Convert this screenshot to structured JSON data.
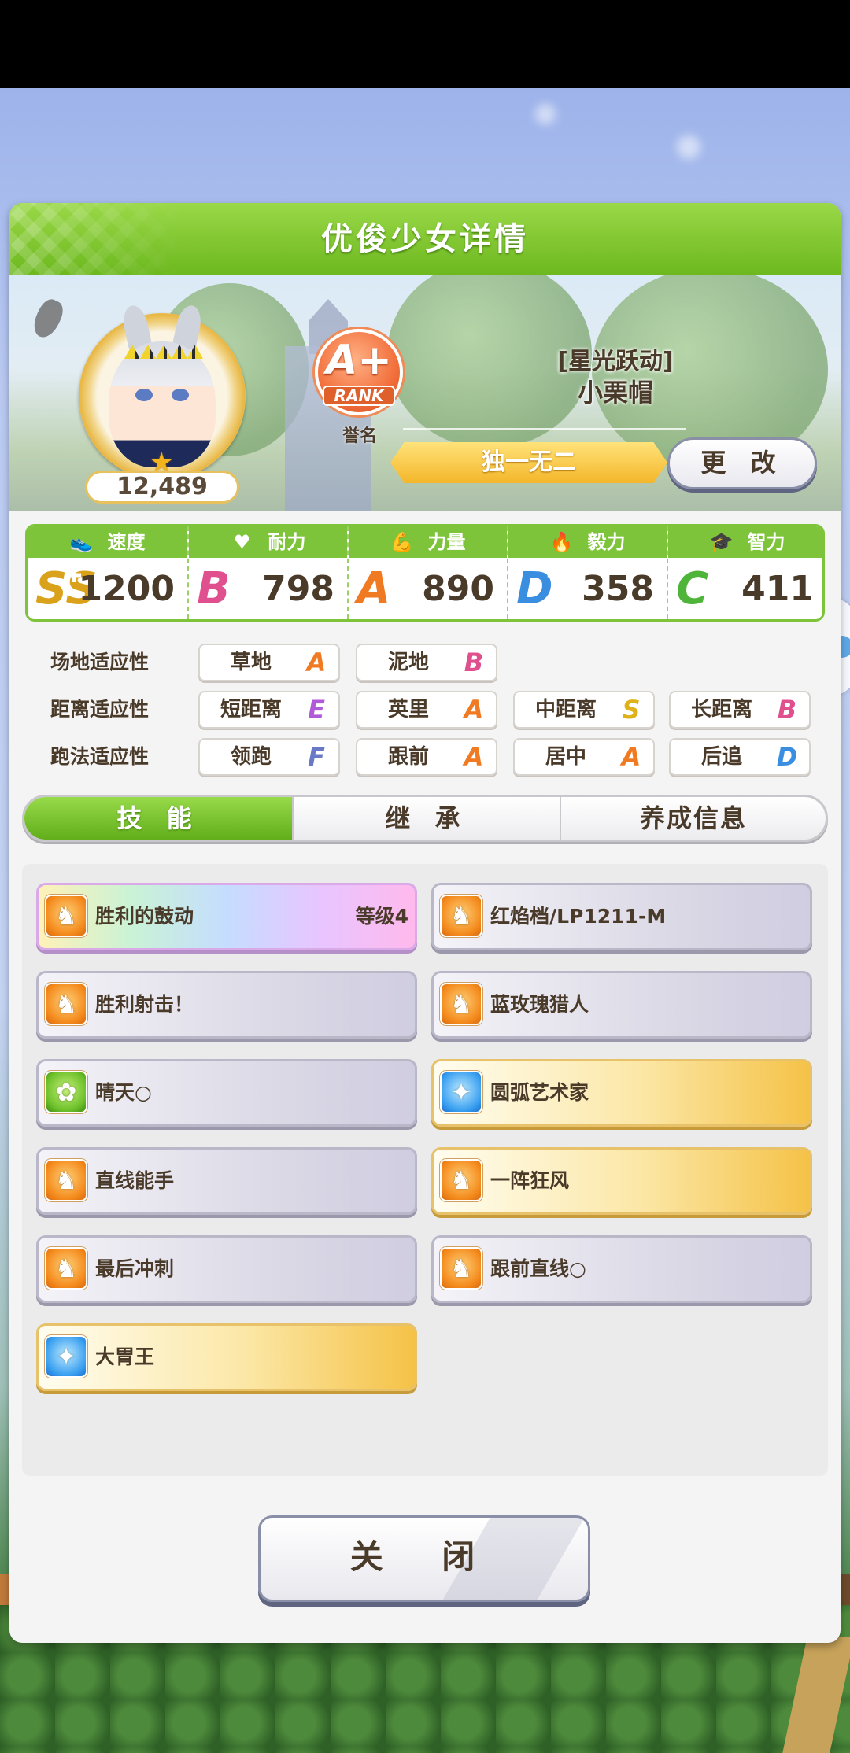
{
  "header": {
    "title": "优俊少女详情"
  },
  "profile": {
    "fans": "12,489",
    "rank_grade": "A+",
    "rank_label": "RANK",
    "fame_label": "誉名",
    "title_prefix": "[星光跃动]",
    "name": "小栗帽",
    "epithet": "独一无二",
    "change_label": "更 改"
  },
  "stats": [
    {
      "label": "速度",
      "icon": "shoe-icon",
      "grade": "SS",
      "plus": "+",
      "value": "1200",
      "color": "#d9a21a"
    },
    {
      "label": "耐力",
      "icon": "heart-icon",
      "grade": "B",
      "plus": "+",
      "value": "798",
      "color": "#e0508e"
    },
    {
      "label": "力量",
      "icon": "muscle-icon",
      "grade": "A",
      "plus": "",
      "value": "890",
      "color": "#f07a22"
    },
    {
      "label": "毅力",
      "icon": "flame-icon",
      "grade": "D",
      "plus": "+",
      "value": "358",
      "color": "#3a8ee0"
    },
    {
      "label": "智力",
      "icon": "graduation-cap-icon",
      "grade": "C",
      "plus": "",
      "value": "411",
      "color": "#4fb43a"
    }
  ],
  "aptitude": {
    "track": {
      "label": "场地适应性",
      "items": [
        {
          "name": "草地",
          "grade": "A"
        },
        {
          "name": "泥地",
          "grade": "B"
        }
      ]
    },
    "distance": {
      "label": "距离适应性",
      "items": [
        {
          "name": "短距离",
          "grade": "E"
        },
        {
          "name": "英里",
          "grade": "A"
        },
        {
          "name": "中距离",
          "grade": "S"
        },
        {
          "name": "长距离",
          "grade": "B"
        }
      ]
    },
    "style": {
      "label": "跑法适应性",
      "items": [
        {
          "name": "领跑",
          "grade": "F"
        },
        {
          "name": "跟前",
          "grade": "A"
        },
        {
          "name": "居中",
          "grade": "A"
        },
        {
          "name": "后追",
          "grade": "D"
        }
      ]
    }
  },
  "grade_colors": {
    "S": "#e0b21a",
    "A": "#f07a22",
    "B": "#e0508e",
    "C": "#4fb43a",
    "D": "#3a8ee0",
    "E": "#b05ad8",
    "F": "#6a78c8"
  },
  "tabs": [
    {
      "label": "技 能",
      "active": true
    },
    {
      "label": "继 承",
      "active": false
    },
    {
      "label": "养成信息",
      "active": false
    }
  ],
  "skills": [
    {
      "name": "胜利的鼓动",
      "level": "等级4",
      "style": "rainbow",
      "icon": "orange"
    },
    {
      "name": "红焰档/LP1211-M",
      "level": "",
      "style": "white",
      "icon": "orange"
    },
    {
      "name": "胜利射击！",
      "level": "",
      "style": "white",
      "icon": "orange"
    },
    {
      "name": "蓝玫瑰猎人",
      "level": "",
      "style": "white",
      "icon": "orange"
    },
    {
      "name": "晴天○",
      "level": "",
      "style": "white",
      "icon": "green"
    },
    {
      "name": "圆弧艺术家",
      "level": "",
      "style": "gold",
      "icon": "blue"
    },
    {
      "name": "直线能手",
      "level": "",
      "style": "white",
      "icon": "orange"
    },
    {
      "name": "一阵狂风",
      "level": "",
      "style": "gold",
      "icon": "orange"
    },
    {
      "name": "最后冲刺",
      "level": "",
      "style": "white",
      "icon": "orange"
    },
    {
      "name": "跟前直线○",
      "level": "",
      "style": "white",
      "icon": "orange"
    },
    {
      "name": "大胃王",
      "level": "",
      "style": "gold",
      "icon": "blue"
    }
  ],
  "footer": {
    "close_label": "关 闭"
  }
}
